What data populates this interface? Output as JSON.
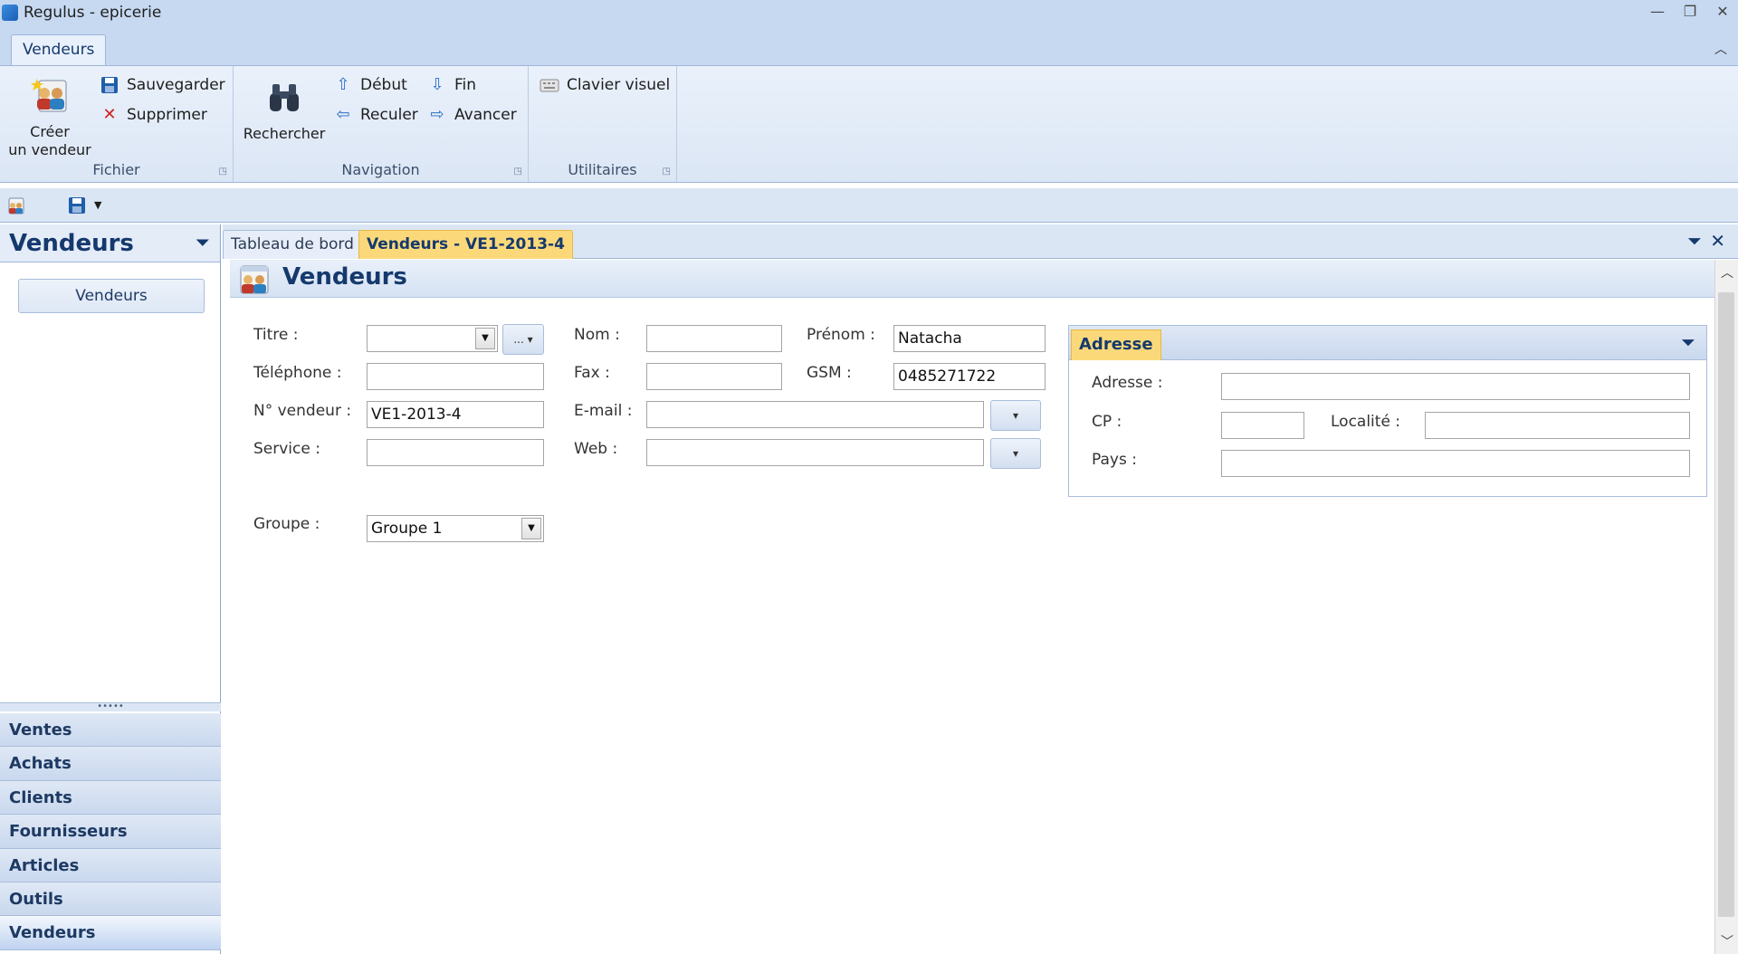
{
  "window": {
    "title": "Regulus - epicerie",
    "controls": {
      "minimize": "—",
      "restore": "❐",
      "close": "✕"
    }
  },
  "ribbon": {
    "tab": "Vendeurs",
    "groups": {
      "fichier": {
        "label": "Fichier",
        "create_line1": "Créer",
        "create_line2": "un vendeur",
        "save": "Sauvegarder",
        "delete": "Supprimer"
      },
      "navigation": {
        "label": "Navigation",
        "search": "Rechercher",
        "first": "Début",
        "last": "Fin",
        "back": "Reculer",
        "forward": "Avancer"
      },
      "utilitaires": {
        "label": "Utilitaires",
        "keyboard": "Clavier visuel"
      }
    }
  },
  "nav_pane": {
    "header": "Vendeurs",
    "button": "Vendeurs",
    "groups": [
      "Ventes",
      "Achats",
      "Clients",
      "Fournisseurs",
      "Articles",
      "Outils",
      "Vendeurs"
    ],
    "active_group": "Vendeurs"
  },
  "doc_tabs": {
    "tab1": "Tableau de bord",
    "tab2": "Vendeurs - VE1-2013-4"
  },
  "panel": {
    "title": "Vendeurs"
  },
  "form": {
    "labels": {
      "titre": "Titre :",
      "telephone": "Téléphone :",
      "n_vendeur": "N° vendeur :",
      "service": "Service :",
      "groupe": "Groupe :",
      "nom": "Nom :",
      "fax": "Fax :",
      "email": "E-mail :",
      "web": "Web :",
      "prenom": "Prénom :",
      "gsm": "GSM :"
    },
    "values": {
      "titre": "",
      "telephone": "",
      "n_vendeur": "VE1-2013-4",
      "service": "",
      "groupe": "Groupe 1",
      "nom": "",
      "fax": "",
      "email": "",
      "web": "",
      "prenom": "Natacha",
      "gsm": "0485271722"
    },
    "ellipsis_button": "..."
  },
  "adresse": {
    "tab": "Adresse",
    "labels": {
      "adresse": "Adresse :",
      "cp": "CP :",
      "localite": "Localité :",
      "pays": "Pays :"
    },
    "values": {
      "adresse": "",
      "cp": "",
      "localite": "",
      "pays": ""
    }
  }
}
